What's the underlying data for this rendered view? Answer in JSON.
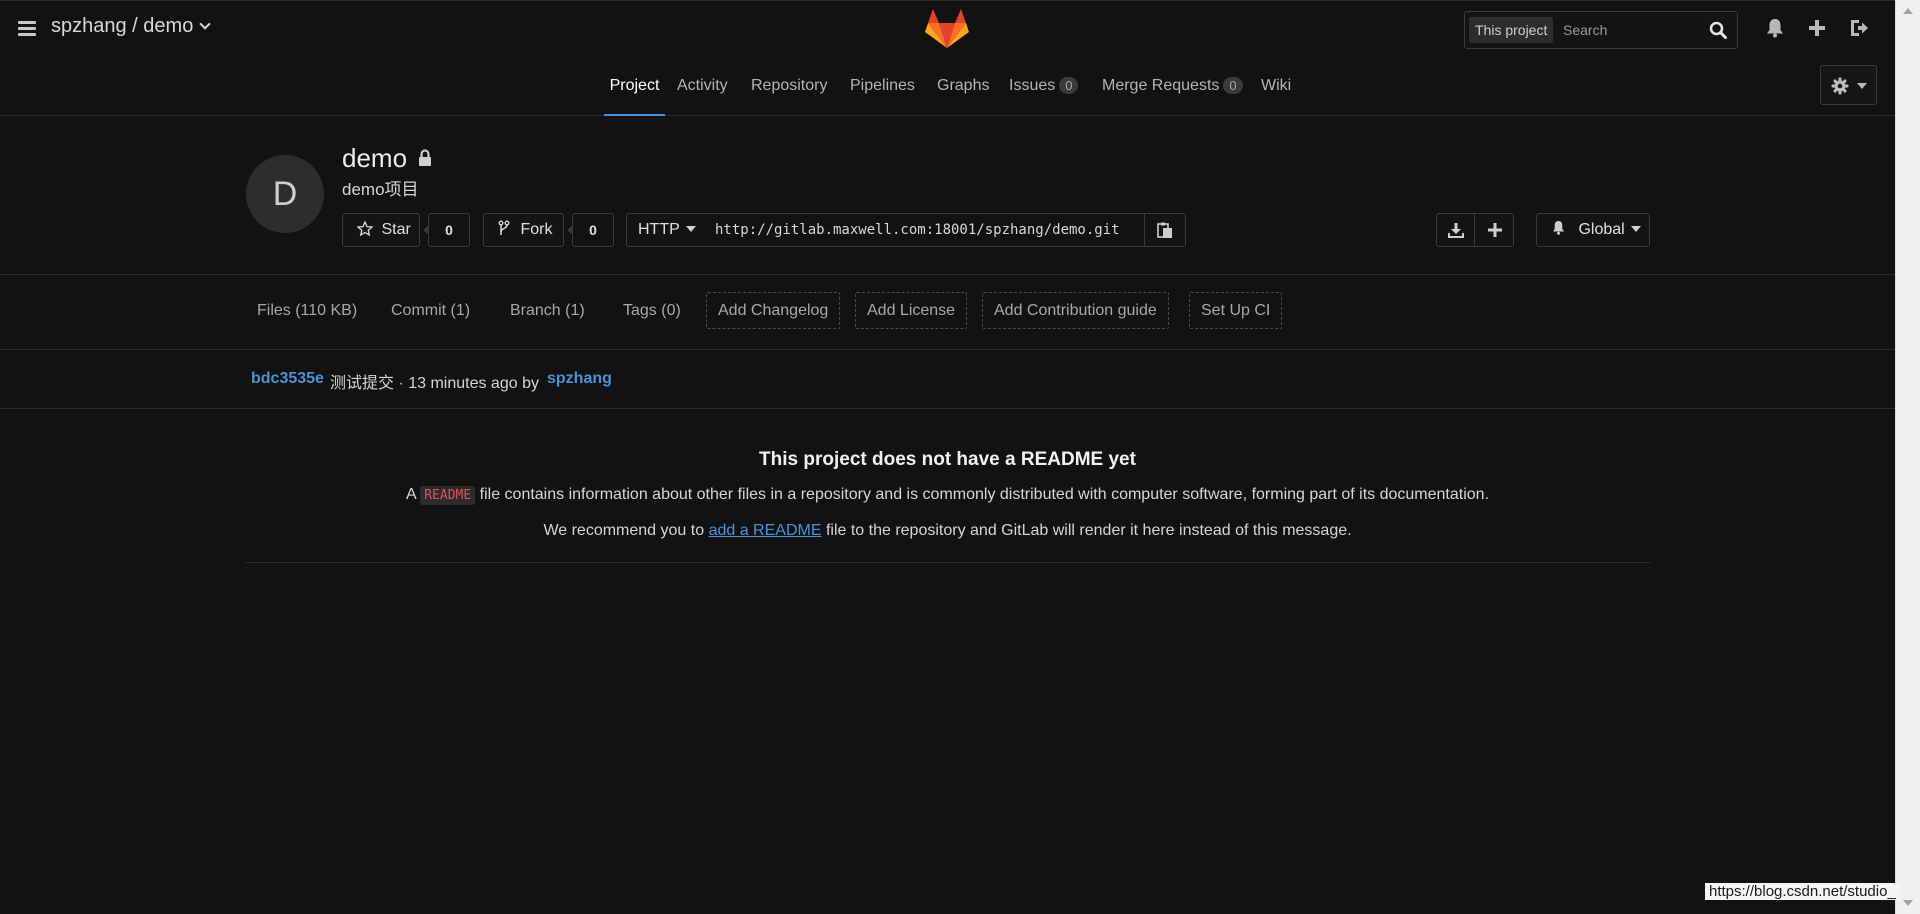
{
  "header": {
    "breadcrumb": "spzhang / demo",
    "search": {
      "scope": "This project",
      "placeholder": "Search"
    }
  },
  "nav": {
    "tabs": [
      {
        "label": "Project",
        "active": true
      },
      {
        "label": "Activity"
      },
      {
        "label": "Repository"
      },
      {
        "label": "Pipelines"
      },
      {
        "label": "Graphs"
      },
      {
        "label": "Issues",
        "badge": "0"
      },
      {
        "label": "Merge Requests",
        "badge": "0"
      },
      {
        "label": "Wiki"
      }
    ]
  },
  "project": {
    "avatar_letter": "D",
    "name": "demo",
    "description": "demo项目",
    "star_label": "Star",
    "star_count": "0",
    "fork_label": "Fork",
    "fork_count": "0",
    "protocol": "HTTP",
    "clone_url": "http://gitlab.maxwell.com:18001/spzhang/demo.git",
    "notification_level": "Global"
  },
  "stats": {
    "files": "Files (110 KB)",
    "commits": "Commit (1)",
    "branches": "Branch (1)",
    "tags": "Tags (0)",
    "add_changelog": "Add Changelog",
    "add_license": "Add License",
    "add_contribution": "Add Contribution guide",
    "setup_ci": "Set Up CI"
  },
  "last_commit": {
    "sha": "bdc3535e",
    "message": "测试提交 · 13 minutes ago by",
    "author": "spzhang"
  },
  "readme": {
    "title": "This project does not have a README yet",
    "line1_prefix": "A",
    "line1_code": "README",
    "line1_suffix": "file contains information about other files in a repository and is commonly distributed with computer software, forming part of its documentation.",
    "line2_prefix": "We recommend you to",
    "line2_link": "add a README",
    "line2_suffix": "file to the repository and GitLab will render it here instead of this message."
  },
  "watermark": "https://blog.csdn.net/studio_",
  "colors": {
    "background": "#121212",
    "link": "#4b93d9",
    "active_tab_underline": "#4a90e2",
    "code_text": "#e04f5f"
  }
}
